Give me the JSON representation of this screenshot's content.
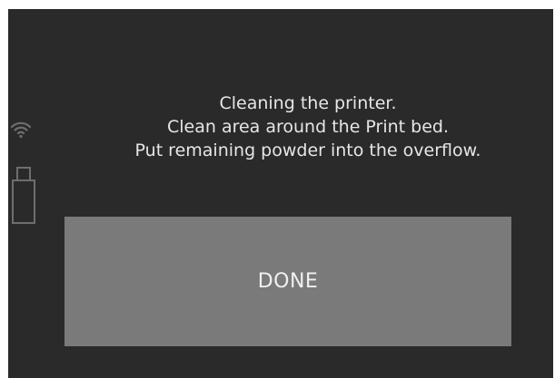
{
  "screen": {
    "background": "#2a2a2a",
    "text_color": "#e6e6e6"
  },
  "status": {
    "icons": [
      "wifi-icon",
      "usb-drive-icon"
    ]
  },
  "message": {
    "lines": [
      "Cleaning the printer.",
      "Clean area around the Print bed.",
      "Put remaining powder into the overflow."
    ]
  },
  "done_button": {
    "label": "DONE",
    "background": "#7a7a7a"
  }
}
